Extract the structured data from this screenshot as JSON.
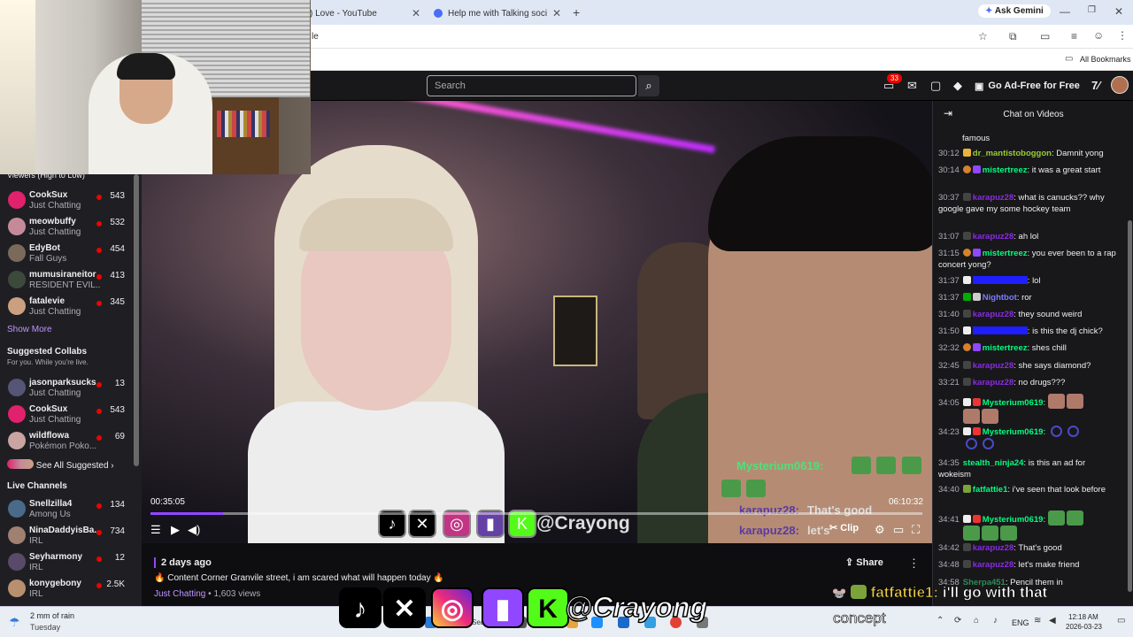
{
  "browser": {
    "tabs": [
      {
        "label": ") Love - YouTube",
        "icon": "youtube-icon"
      },
      {
        "label": "Help me with Talking social Ski",
        "icon": "gemini-icon"
      }
    ],
    "ask_gemini": "Ask Gemini",
    "address_fragment": "le",
    "bookmarks_label": "All Bookmarks"
  },
  "header": {
    "search_placeholder": "Search",
    "notification_count": "33",
    "ad_free_label": "Go Ad-Free for Free"
  },
  "sidebar": {
    "sort_label": "Viewers (High to Low)",
    "followed": [
      {
        "name": "CookSux",
        "category": "Just Chatting",
        "viewers": "543",
        "color": "#e0216b"
      },
      {
        "name": "meowbuffy",
        "category": "Just Chatting",
        "viewers": "532",
        "color": "#c58a9a"
      },
      {
        "name": "EdyBot",
        "category": "Fall Guys",
        "viewers": "454",
        "color": "#7a6a5a"
      },
      {
        "name": "mumusiraneitor",
        "category": "RESIDENT EVIL...",
        "viewers": "413",
        "color": "#3c4a3c"
      },
      {
        "name": "fatalevie",
        "category": "Just Chatting",
        "viewers": "345",
        "color": "#caa080"
      }
    ],
    "show_more": "Show More",
    "suggested_title": "Suggested Collabs",
    "suggested_sub": "For you. While you're live.",
    "suggested": [
      {
        "name": "jasonparksucks",
        "category": "Just Chatting",
        "viewers": "13",
        "color": "#557"
      },
      {
        "name": "CookSux",
        "category": "Just Chatting",
        "viewers": "543",
        "color": "#e0216b"
      },
      {
        "name": "wildflowa",
        "category": "Pokémon Poko...",
        "viewers": "69",
        "color": "#c9a4a0"
      }
    ],
    "see_all": "See All Suggested",
    "live_title": "Live Channels",
    "live": [
      {
        "name": "Snellzilla4",
        "category": "Among Us",
        "viewers": "134",
        "color": "#4a6a8a"
      },
      {
        "name": "NinaDaddyisBa...",
        "category": "IRL",
        "viewers": "734",
        "color": "#a08070"
      },
      {
        "name": "Seyharmony",
        "category": "IRL",
        "viewers": "12",
        "color": "#5a4a6a"
      },
      {
        "name": "konygebony",
        "category": "IRL",
        "viewers": "2.5K",
        "color": "#b89070"
      }
    ]
  },
  "video": {
    "overlay_handle": "@Crayong",
    "overlay_chat_user": "Mysterium0619:",
    "overlay_chat_user2": "karapuz28:",
    "overlay_chat_text2": "That's good",
    "overlay_chat_user3": "karapuz28:",
    "overlay_chat_text3": "let's",
    "current_time": "00:35:05",
    "total_time": "06:10:32",
    "progress": 0.094,
    "clip_label": "Clip",
    "upload_date": "2 days ago",
    "title": "Content Corner Granvile street, i am scared what will happen today",
    "category": "Just Chatting",
    "views": "1,603 views",
    "share_label": "Share"
  },
  "chat": {
    "title": "Chat on Videos",
    "messages": [
      {
        "ts": "",
        "user": "",
        "color": "#efeff1",
        "text": "famous"
      },
      {
        "ts": "30:12",
        "user": "dr_mantistoboggon",
        "color": "#9acd32",
        "text": "Damnit yong"
      },
      {
        "ts": "30:14",
        "user": "mistertreez",
        "color": "#00ff7f",
        "text": "it was a great start"
      },
      {
        "ts": "30:37",
        "user": "karapuz28",
        "color": "#8a2be2",
        "text": "what is canucks?? why google gave my some hockey team"
      },
      {
        "ts": "31:07",
        "user": "karapuz28",
        "color": "#8a2be2",
        "text": "ah lol"
      },
      {
        "ts": "31:15",
        "user": "mistertreez",
        "color": "#00ff7f",
        "text": "you ever been to a rap concert yong?"
      },
      {
        "ts": "31:37",
        "user": "",
        "color": "#1e1eff",
        "text": "lol"
      },
      {
        "ts": "31:37",
        "user": "Nightbot",
        "color": "#7c7cff",
        "text": "ror"
      },
      {
        "ts": "31:40",
        "user": "karapuz28",
        "color": "#8a2be2",
        "text": "they sound weird"
      },
      {
        "ts": "31:50",
        "user": "",
        "color": "#1e1eff",
        "text": "is this the dj chick?"
      },
      {
        "ts": "32:32",
        "user": "mistertreez",
        "color": "#00ff7f",
        "text": "shes chill"
      },
      {
        "ts": "32:45",
        "user": "karapuz28",
        "color": "#8a2be2",
        "text": "she says diamond?"
      },
      {
        "ts": "33:21",
        "user": "karapuz28",
        "color": "#8a2be2",
        "text": "no drugs???"
      },
      {
        "ts": "34:05",
        "user": "Mysterium0619",
        "color": "#00ff7f",
        "text": ""
      },
      {
        "ts": "34:23",
        "user": "Mysterium0619",
        "color": "#00ff7f",
        "text": ""
      },
      {
        "ts": "34:35",
        "user": "stealth_ninja24",
        "color": "#00ff7f",
        "text": "is this an ad for wokeism"
      },
      {
        "ts": "34:40",
        "user": "fatfattie1",
        "color": "#00ff7f",
        "text": "i've seen that look before"
      },
      {
        "ts": "34:41",
        "user": "Mysterium0619",
        "color": "#00ff7f",
        "text": ""
      },
      {
        "ts": "34:42",
        "user": "karapuz28",
        "color": "#8a2be2",
        "text": "That's good"
      },
      {
        "ts": "34:48",
        "user": "karapuz28",
        "color": "#8a2be2",
        "text": "let's make friend"
      },
      {
        "ts": "34:58",
        "user": "Sherpa451",
        "color": "#2e8b57",
        "text": "Pencil them in"
      }
    ]
  },
  "stream_overlay": {
    "handle": "@Crayong",
    "caption_user": "fatfattie1:",
    "caption_text": "i'll go with that",
    "caption_line2": "concept"
  },
  "taskbar": {
    "weather_temp": "2 mm of rain",
    "weather_day": "Tuesday",
    "search_label": "Search",
    "lang": "ENG",
    "time": "12:18 AM",
    "date": "2026-03-23"
  }
}
